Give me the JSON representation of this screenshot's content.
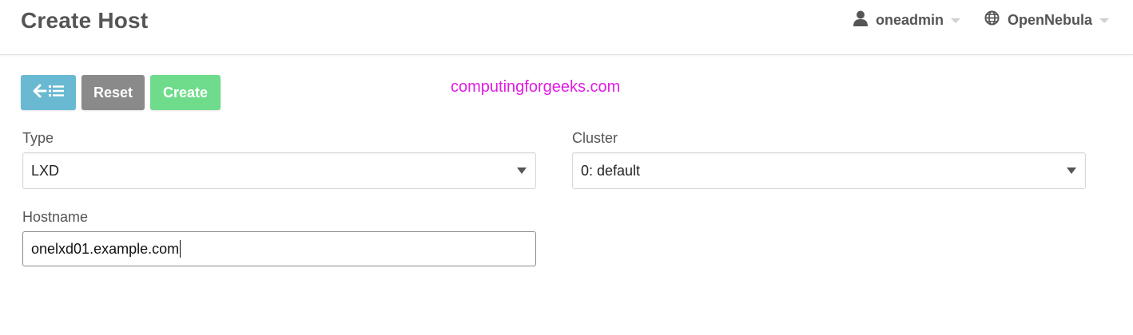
{
  "header": {
    "title": "Create Host",
    "user_menu": {
      "icon": "user-icon",
      "label": "oneadmin"
    },
    "zone_menu": {
      "icon": "globe-icon",
      "label": "OpenNebula"
    }
  },
  "toolbar": {
    "back_icon": "back-to-list-icon",
    "reset_label": "Reset",
    "create_label": "Create"
  },
  "watermark": "computingforgeeks.com",
  "form": {
    "type": {
      "label": "Type",
      "value": "LXD"
    },
    "cluster": {
      "label": "Cluster",
      "value": "0: default"
    },
    "hostname": {
      "label": "Hostname",
      "value": "onelxd01.example.com"
    }
  },
  "colors": {
    "back_button": "#6ab9d3",
    "reset_button": "#8a8a8a",
    "create_button": "#6fdc8c",
    "watermark": "#e11de3"
  }
}
